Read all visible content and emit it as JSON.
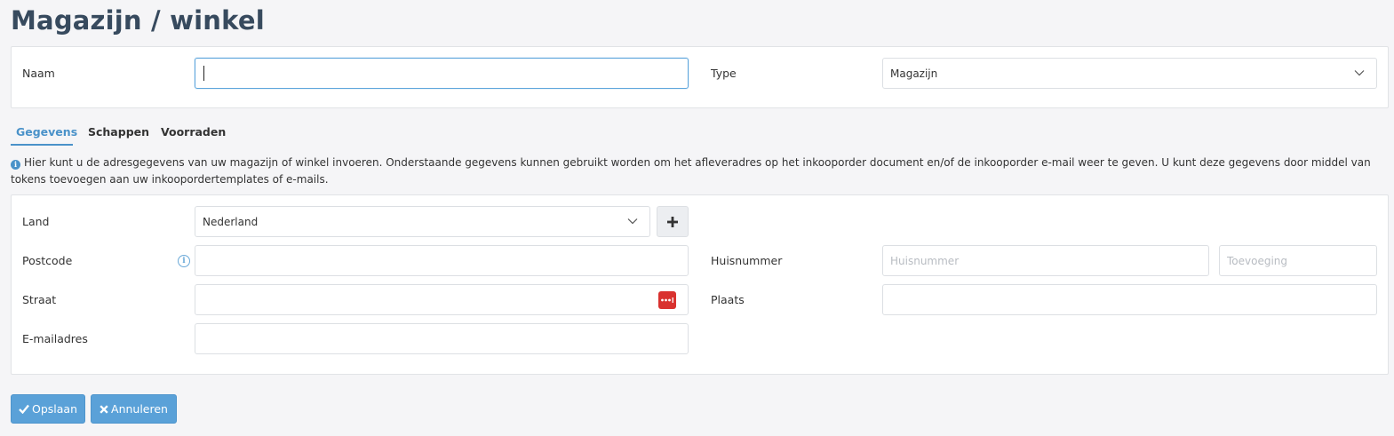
{
  "page": {
    "title": "Magazijn / winkel"
  },
  "header_form": {
    "naam_label": "Naam",
    "naam_value": "",
    "type_label": "Type",
    "type_selected": "Magazijn"
  },
  "tabs": [
    {
      "label": "Gegevens",
      "active": true
    },
    {
      "label": "Schappen",
      "active": false
    },
    {
      "label": "Voorraden",
      "active": false
    }
  ],
  "info": {
    "icon": "info-icon",
    "text": "Hier kunt u de adresgegevens van uw magazijn of winkel invoeren. Onderstaande gegevens kunnen gebruikt worden om het afleveradres op het inkooporder document en/of de inkooporder e-mail weer te geven. U kunt deze gegevens door middel van tokens toevoegen aan uw inkoopordertemplates of e-mails."
  },
  "address_form": {
    "land_label": "Land",
    "land_selected": "Nederland",
    "postcode_label": "Postcode",
    "postcode_value": "",
    "huisnummer_label": "Huisnummer",
    "huisnummer_placeholder": "Huisnummer",
    "toevoeging_placeholder": "Toevoeging",
    "straat_label": "Straat",
    "straat_value": "",
    "plaats_label": "Plaats",
    "plaats_value": "",
    "email_label": "E-mailadres",
    "email_value": ""
  },
  "actions": {
    "save_label": "Opslaan",
    "cancel_label": "Annuleren"
  },
  "colors": {
    "accent": "#4a92c9",
    "button": "#5aa1d8",
    "title": "#374a5e",
    "password_icon": "#d9322f"
  }
}
